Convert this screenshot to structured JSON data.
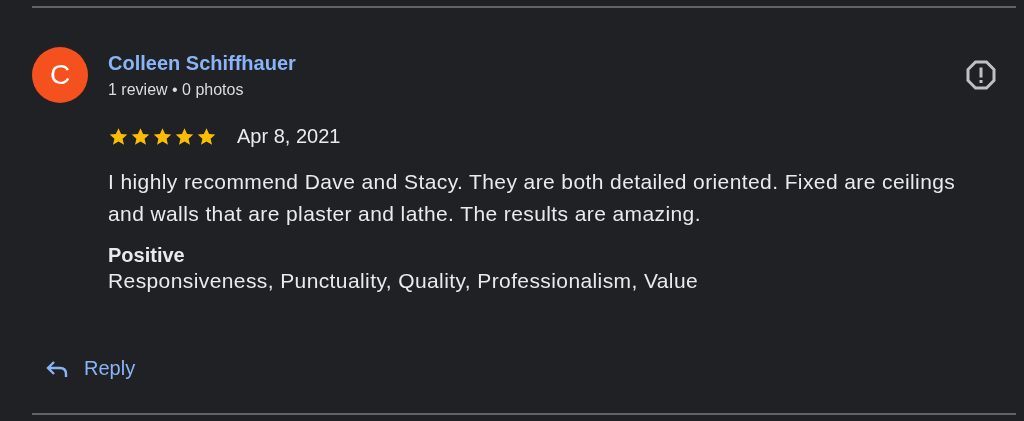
{
  "review": {
    "avatar_letter": "C",
    "author": "Colleen Schiffhauer",
    "meta": "1 review • 0 photos",
    "stars": 5,
    "date": "Apr 8, 2021",
    "text": "I highly recommend Dave and Stacy. They are both detailed oriented. Fixed are ceilings and walls that are plaster and lathe. The results are amazing.",
    "attributes_heading": "Positive",
    "attributes": "Responsiveness, Punctuality, Quality, Professionalism, Value",
    "reply_label": "Reply"
  }
}
